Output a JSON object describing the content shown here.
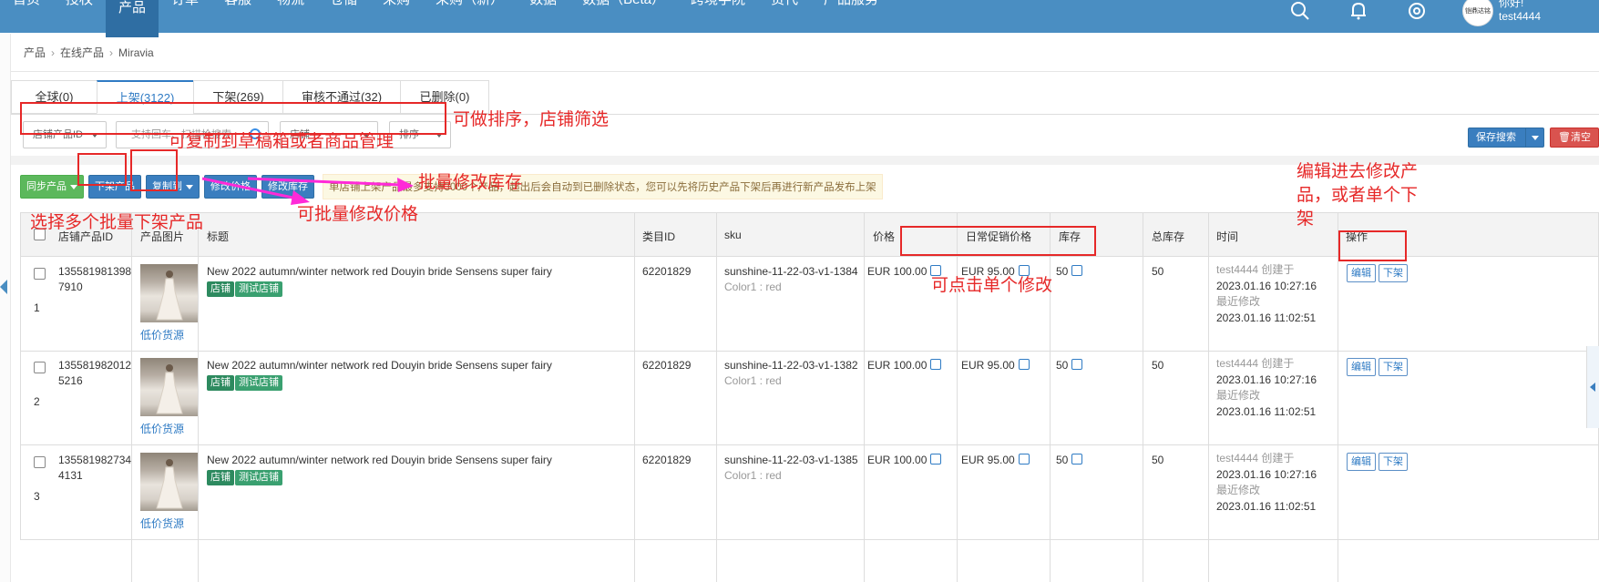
{
  "nav": {
    "items": [
      "首页",
      "授权",
      "产品",
      "订单",
      "客服",
      "物流",
      "仓储",
      "采购",
      "采购（新）",
      "数据",
      "数据（Beta）",
      "跨境学院",
      "货代",
      "产品服务"
    ],
    "active": "产品",
    "greeting": "你好!",
    "username": "test4444",
    "logo_text": "铠鼎达铭"
  },
  "breadcrumb": [
    "产品",
    "在线产品",
    "Miravia"
  ],
  "tabs": [
    "全球(0)",
    "上架(3122)",
    "下架(269)",
    "审核不通过(32)",
    "已删除(0)"
  ],
  "active_tab": "上架(3122)",
  "filters": {
    "shop_product_id": "店铺产品ID",
    "search_placeholder": "支持回车、扫描枪搜索",
    "shop": "店铺",
    "sort": "排序"
  },
  "toolbar": {
    "save_search": "保存搜索",
    "clear": "清空",
    "sync": "同步产品",
    "delist": "下架产品",
    "copy_to": "复制到",
    "edit_price": "修改价格",
    "edit_stock": "修改库存",
    "notice": "单店铺上架产品最多支持3000个产品，超出后会自动到已删除状态，您可以先将历史产品下架后再进行新产品发布上架"
  },
  "columns": [
    "店铺产品ID",
    "产品图片",
    "标题",
    "类目ID",
    "sku",
    "价格",
    "日常促销价格",
    "库存",
    "总库存",
    "时间",
    "操作"
  ],
  "rows": [
    {
      "index": "1",
      "id_line1": "135581981398",
      "id_line2": "7910",
      "source": "低价货源",
      "title": "New 2022 autumn/winter network red Douyin bride Sensens super fairy",
      "tag1": "店铺",
      "tag2": "测试店铺",
      "category": "62201829",
      "sku": "sunshine-11-22-03-v1-1384",
      "variant": "Color1 : red",
      "price": "EUR 100.00",
      "promo": "EUR 95.00",
      "stock": "50",
      "total": "50",
      "created_by": "test4444 创建于",
      "created_at": "2023.01.16 10:27:16",
      "modified_label": "最近修改",
      "modified_at": "2023.01.16 11:02:51",
      "edit": "编辑",
      "delist": "下架"
    },
    {
      "index": "2",
      "id_line1": "135581982012",
      "id_line2": "5216",
      "source": "低价货源",
      "title": "New 2022 autumn/winter network red Douyin bride Sensens super fairy",
      "tag1": "店铺",
      "tag2": "测试店铺",
      "category": "62201829",
      "sku": "sunshine-11-22-03-v1-1382",
      "variant": "Color1 : red",
      "price": "EUR 100.00",
      "promo": "EUR 95.00",
      "stock": "50",
      "total": "50",
      "created_by": "test4444 创建于",
      "created_at": "2023.01.16 10:27:16",
      "modified_label": "最近修改",
      "modified_at": "2023.01.16 11:02:51",
      "edit": "编辑",
      "delist": "下架"
    },
    {
      "index": "3",
      "id_line1": "135581982734",
      "id_line2": "4131",
      "source": "低价货源",
      "title": "New 2022 autumn/winter network red Douyin bride Sensens super fairy",
      "tag1": "店铺",
      "tag2": "测试店铺",
      "category": "62201829",
      "sku": "sunshine-11-22-03-v1-1385",
      "variant": "Color1 : red",
      "price": "EUR 100.00",
      "promo": "EUR 95.00",
      "stock": "50",
      "total": "50",
      "created_by": "test4444 创建于",
      "created_at": "2023.01.16 10:27:16",
      "modified_label": "最近修改",
      "modified_at": "2023.01.16 11:02:51",
      "edit": "编辑",
      "delist": "下架"
    }
  ],
  "annotations": {
    "sort_filter": "可做排序，店铺筛选",
    "copy": "可复制到草稿箱或者商品管理",
    "batch_stock": "批量修改库存",
    "batch_price": "可批量修改价格",
    "batch_delist": "选择多个批量下架产品",
    "single_edit": "可点击单个修改",
    "edit_line1": "编辑进去修改产",
    "edit_line2": "品，或者单个下",
    "edit_line3": "架"
  },
  "colors": {
    "nav_bg": "#4a8ec2",
    "accent": "#2f7bc4",
    "annotation": "#e62828",
    "arrow": "#ff2ad8"
  }
}
